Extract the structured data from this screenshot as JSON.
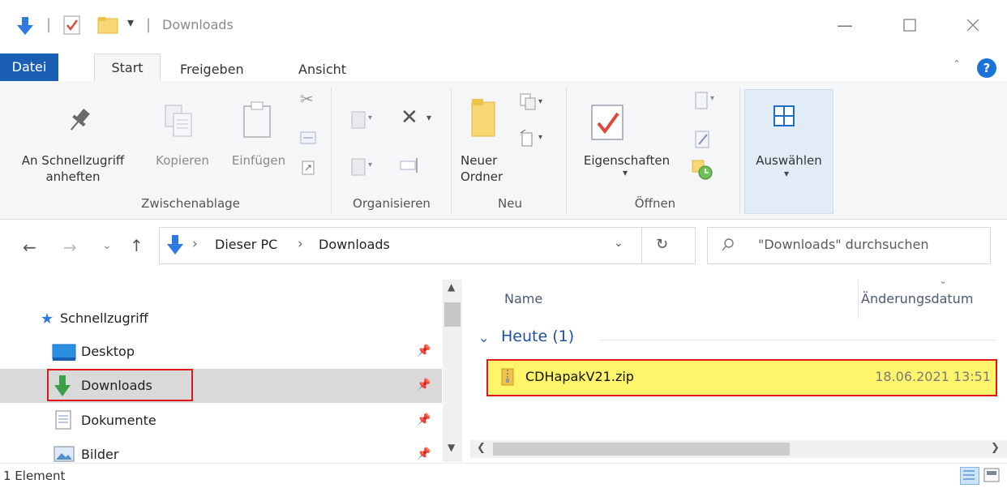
{
  "window": {
    "title": "Downloads"
  },
  "ribbon_tabs": [
    "Datei",
    "Start",
    "Freigeben",
    "Ansicht"
  ],
  "help_glyph": "?",
  "ribbon": {
    "zwischenablage": {
      "pin_label": "An Schnellzugriff anheften",
      "copy_label": "Kopieren",
      "paste_label": "Einfügen",
      "group_label": "Zwischenablage"
    },
    "organisieren": {
      "group_label": "Organisieren"
    },
    "neu": {
      "new_folder_label": "Neuer Ordner",
      "group_label": "Neu"
    },
    "oeffnen": {
      "properties_label": "Eigenschaften",
      "group_label": "Öffnen"
    },
    "auswaehlen": {
      "select_label": "Auswählen"
    }
  },
  "address": {
    "path": [
      "Dieser PC",
      "Downloads"
    ],
    "separator": "›"
  },
  "search": {
    "placeholder": "\"Downloads\" durchsuchen"
  },
  "nav": {
    "schnellzugriff": "Schnellzugriff",
    "items": [
      {
        "label": "Desktop",
        "icon": "desktop-icon"
      },
      {
        "label": "Downloads",
        "icon": "download-arrow-icon",
        "selected": true
      },
      {
        "label": "Dokumente",
        "icon": "document-icon"
      },
      {
        "label": "Bilder",
        "icon": "pictures-icon"
      }
    ]
  },
  "columns": {
    "name": "Name",
    "date": "Änderungsdatum"
  },
  "group_header": "Heute (1)",
  "files": [
    {
      "name": "CDHapakV21.zip",
      "date": "18.06.2021 13:51",
      "icon": "zip-icon"
    }
  ],
  "status": {
    "count": "1 Element"
  },
  "colors": {
    "accent": "#1b5fb5",
    "highlight_yellow": "#fff56a",
    "highlight_red": "#e0161b",
    "nav_selected": "#d9d9d9"
  }
}
